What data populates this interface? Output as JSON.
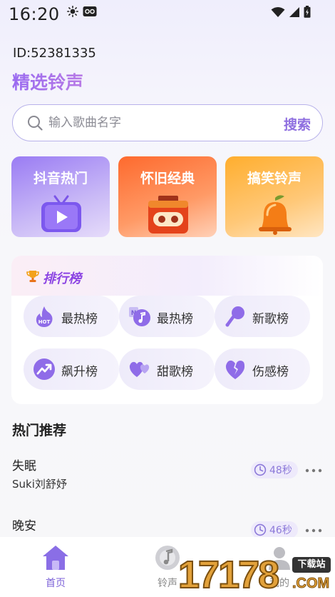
{
  "status_bar": {
    "time": "16:20",
    "icons": [
      "brightness-icon",
      "vpn-icon",
      "wifi-icon",
      "signal-icon",
      "battery-icon"
    ]
  },
  "user": {
    "id_text": "ID:52381335"
  },
  "page": {
    "title": "精选铃声"
  },
  "search": {
    "placeholder": "输入歌曲名字",
    "value": "",
    "button_label": "搜索"
  },
  "categories": [
    {
      "label": "抖音热门",
      "icon": "tv-play-icon"
    },
    {
      "label": "怀旧经典",
      "icon": "radio-icon"
    },
    {
      "label": "搞笑铃声",
      "icon": "bell-icon"
    }
  ],
  "ranking": {
    "title": "排行榜",
    "items": [
      {
        "label": "最热榜",
        "icon": "hot-flame-icon"
      },
      {
        "label": "最热榜",
        "icon": "music-note-icon"
      },
      {
        "label": "新歌榜",
        "icon": "microphone-icon"
      },
      {
        "label": "飙升榜",
        "icon": "trend-up-icon"
      },
      {
        "label": "甜歌榜",
        "icon": "hearts-icon"
      },
      {
        "label": "伤感榜",
        "icon": "broken-heart-icon"
      }
    ]
  },
  "hot": {
    "title": "热门推荐",
    "songs": [
      {
        "title": "失眠",
        "artist": "Suki刘舒妤",
        "duration": "48秒"
      },
      {
        "title": "晚安",
        "artist": "",
        "duration": "46秒"
      }
    ]
  },
  "tabs": [
    {
      "label": "首页",
      "active": true,
      "icon": "home-icon"
    },
    {
      "label": "铃声",
      "active": false,
      "icon": "music-disc-icon"
    },
    {
      "label": "我的",
      "active": false,
      "icon": "user-icon"
    }
  ],
  "watermark": {
    "digits": "17178",
    "badge": "下载站",
    "domain": ".COM"
  },
  "colors": {
    "accent": "#8f6fe0",
    "title_gradient_start": "#9a6bf0",
    "ranking_title": "#8c45e3"
  }
}
